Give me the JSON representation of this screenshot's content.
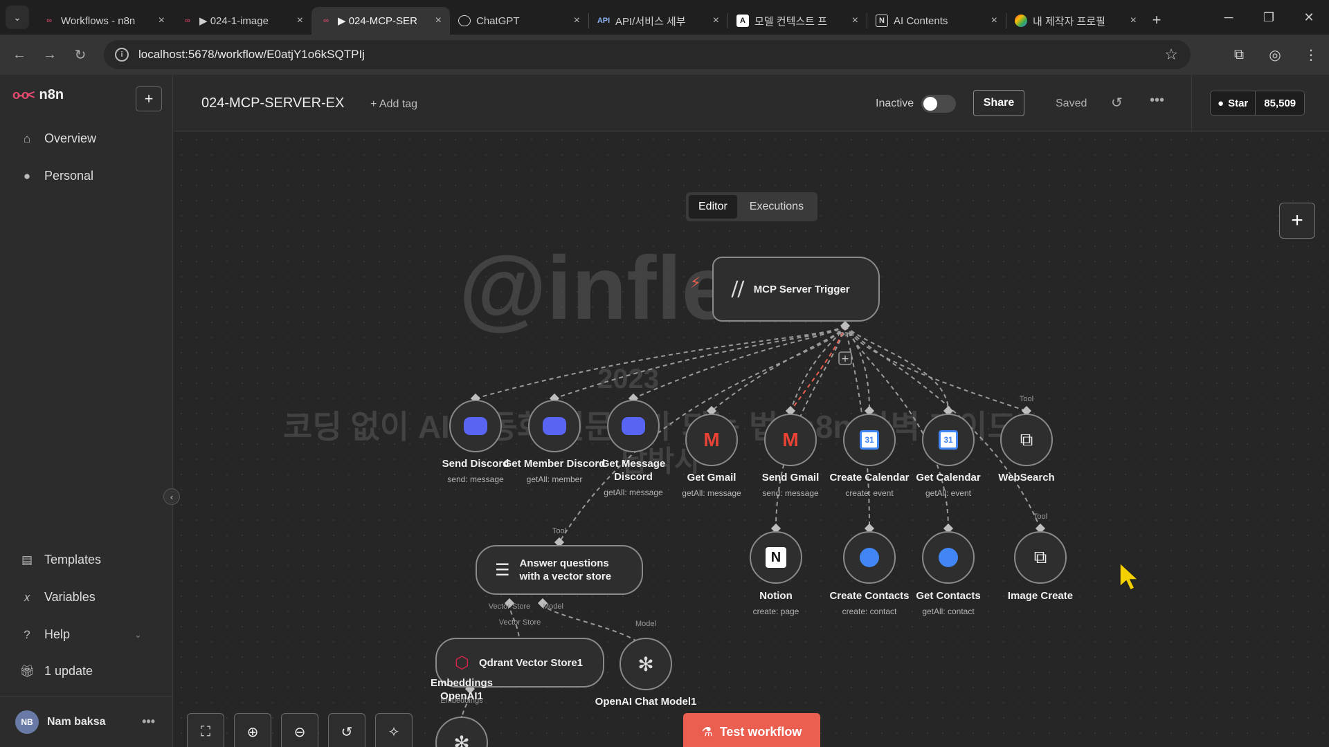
{
  "browser": {
    "tabs": [
      {
        "label": "Workflows - n8n",
        "icon": "n8n-icon",
        "active": false
      },
      {
        "label": "▶ 024-1-image",
        "icon": "n8n-icon",
        "active": false
      },
      {
        "label": "▶ 024-MCP-SER",
        "icon": "n8n-icon",
        "active": true
      },
      {
        "label": "ChatGPT",
        "icon": "chatgpt-icon",
        "active": false
      },
      {
        "label": "API/서비스 세부",
        "icon": "api-icon",
        "active": false
      },
      {
        "label": "모델 컨텍스트 프",
        "icon": "anthropic-icon",
        "active": false
      },
      {
        "label": "AI Contents",
        "icon": "notion-icon",
        "active": false
      },
      {
        "label": "내 제작자 프로필",
        "icon": "profile-icon",
        "active": false
      }
    ],
    "url": "localhost:5678/workflow/E0atjY1o6kSQTPIj"
  },
  "sidebar": {
    "brand": "n8n",
    "items": [
      {
        "label": "Overview",
        "icon": "home-icon"
      },
      {
        "label": "Personal",
        "icon": "user-icon"
      }
    ],
    "bottom_items": [
      {
        "label": "Templates",
        "icon": "templates-icon"
      },
      {
        "label": "Variables",
        "icon": "variables-icon"
      },
      {
        "label": "Help",
        "icon": "help-icon"
      },
      {
        "label": "1 update",
        "icon": "gift-icon"
      }
    ],
    "user": {
      "initials": "NB",
      "name": "Nam baksa"
    }
  },
  "header": {
    "workflow_name": "024-MCP-SERVER-EX",
    "add_tag": "+ Add tag",
    "status": "Inactive",
    "share": "Share",
    "saved": "Saved",
    "github_star": "Star",
    "github_count": "85,509"
  },
  "tabs": {
    "editor": "Editor",
    "executions": "Executions"
  },
  "nodes": {
    "trigger": "MCP Server Trigger",
    "trigger_port": "Tools",
    "send_discord": {
      "label": "Send Discord",
      "sub": "send: message"
    },
    "get_member_discord": {
      "label": "Get Member Discord",
      "sub": "getAll: member"
    },
    "get_message_discord": {
      "label": "Get Message Discord",
      "sub": "getAll: message"
    },
    "get_gmail": {
      "label": "Get Gmail",
      "sub": "getAll: message"
    },
    "send_gmail": {
      "label": "Send Gmail",
      "sub": "send: message"
    },
    "create_calendar": {
      "label": "Create Calendar",
      "sub": "create: event"
    },
    "get_calendar": {
      "label": "Get Calendar",
      "sub": "getAll: event"
    },
    "websearch": {
      "label": "WebSearch",
      "port": "Tool"
    },
    "notion": {
      "label": "Notion",
      "sub": "create: page"
    },
    "create_contacts": {
      "label": "Create Contacts",
      "sub": "create: contact"
    },
    "get_contacts": {
      "label": "Get Contacts",
      "sub": "getAll: contact"
    },
    "image_create": {
      "label": "Image Create",
      "port": "Tool"
    },
    "answer_vs": {
      "label_1": "Answer questions",
      "label_2": "with a vector store",
      "port_top": "Tool",
      "port_vs": "Vector Store",
      "port_model": "Model"
    },
    "qdrant": {
      "label": "Qdrant Vector Store1",
      "port_top": "Vector Store",
      "port_bottom": "Embeddings"
    },
    "openai_chat": {
      "label": "OpenAI Chat Model1",
      "port_top": "Model"
    },
    "embeddings": {
      "label_1": "Embeddings",
      "label_2": "OpenAI1"
    }
  },
  "watermark": {
    "brand": "@inflearn",
    "year": "2023",
    "title": "코딩 없이 AI 자동화 전문가가 되는 법, n8n 완벽 가이드",
    "author": "남박사"
  },
  "test_button": "Test workflow",
  "colors": {
    "accent": "#ea5f4f",
    "brand": "#ea4b71",
    "discord": "#5865f2"
  }
}
